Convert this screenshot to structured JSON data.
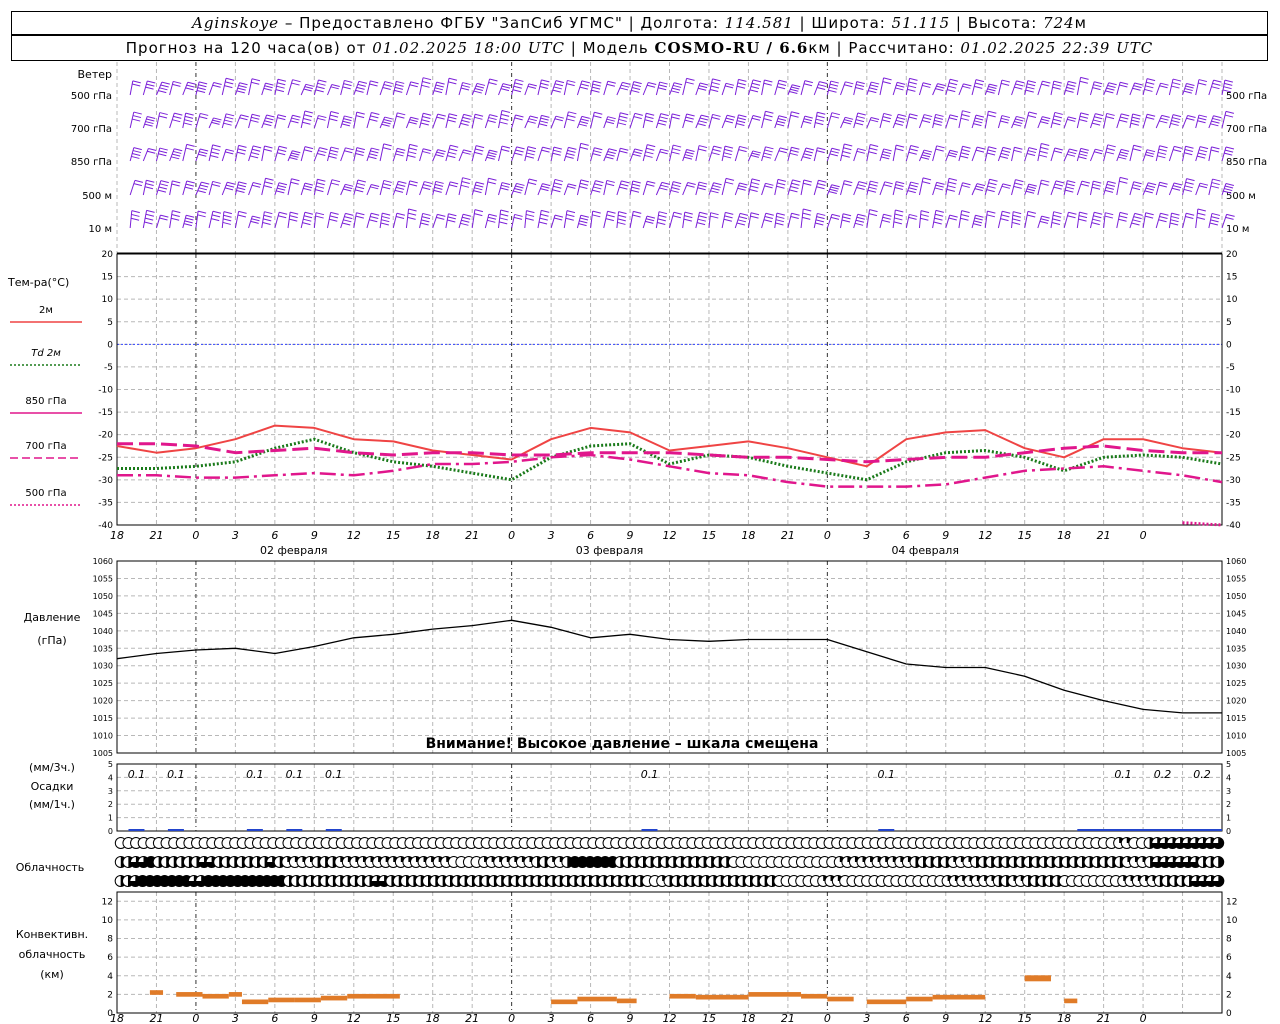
{
  "header": {
    "line1": {
      "station": "Aginskoye",
      "provider": " – Предоставлено ФГБУ \"ЗапСиб УГМС\" | Долгота: ",
      "longitude": "114.581",
      "lat_label": " | Широта: ",
      "latitude": "51.115",
      "alt_label": " | Высота: ",
      "altitude": "724",
      "alt_unit": "м"
    },
    "line2": {
      "forecast_label": "Прогноз на 120 часа(ов) от ",
      "issued": "01.02.2025 18:00 UTC",
      "model_label": " | Модель ",
      "model": "COSMO-RU / 6.6",
      "model_unit": "км",
      "calc_label": " | Рассчитано: ",
      "calculated": "01.02.2025 22:39 UTC"
    }
  },
  "axis": {
    "hour_ticks": [
      "18",
      "21",
      "0",
      "3",
      "6",
      "9",
      "12",
      "15",
      "18",
      "21",
      "0",
      "3",
      "6",
      "9",
      "12",
      "15",
      "18",
      "21",
      "0",
      "3",
      "6",
      "9",
      "12",
      "15",
      "18",
      "21",
      "0"
    ],
    "dates": [
      "02 февраля",
      "03 февраля",
      "04 февраля"
    ]
  },
  "panels": {
    "wind": {
      "title": "Ветер",
      "levels": [
        "500 гПа",
        "700 гПа",
        "850 гПа",
        "500 м",
        "10 м"
      ],
      "color": "#7b1fd8"
    },
    "temperature": {
      "title": "Тем-ра(°C)",
      "legend": [
        {
          "label": "2м",
          "color": "#ef4444",
          "style": "solid"
        },
        {
          "label": "Td 2м",
          "color": "#1a7a1a",
          "style": "dotted"
        },
        {
          "label": "850 гПа",
          "color": "#e0168c",
          "style": "solid"
        },
        {
          "label": "700 гПа",
          "color": "#e0168c",
          "style": "dashed"
        },
        {
          "label": "500 гПа",
          "color": "#e0168c",
          "style": "dotted"
        }
      ],
      "ticks": [
        "20",
        "15",
        "10",
        "5",
        "0",
        "-5",
        "-10",
        "-15",
        "-20",
        "-25",
        "-30",
        "-35",
        "-40"
      ]
    },
    "pressure": {
      "title1": "Давление",
      "title2": "(гПа)",
      "ticks": [
        "1060",
        "1055",
        "1050",
        "1045",
        "1040",
        "1035",
        "1030",
        "1025",
        "1020",
        "1015",
        "1010",
        "1005"
      ],
      "warning": "Внимание! Высокое давление – шкала смещена"
    },
    "precip": {
      "unit3h": "(мм/3ч.)",
      "title": "Осадки",
      "unit1h": "(мм/1ч.)",
      "ticks": [
        "5",
        "4",
        "3",
        "2",
        "1",
        "0"
      ],
      "labels": [
        "0.1",
        "0.1",
        "0.1",
        "0.1",
        "0.1",
        "0.1",
        "0.1",
        "0.1",
        "0.2",
        "0.2"
      ]
    },
    "cloud": {
      "title": "Облачность"
    },
    "convective": {
      "title1": "Конвективн.",
      "title2": "облачность",
      "title3": "(км)",
      "ticks": [
        "12",
        "10",
        "8",
        "6",
        "4",
        "2",
        "0"
      ]
    }
  },
  "chart_data": [
    {
      "type": "line",
      "title": "Тем-ра(°C)",
      "x_hours": [
        -6,
        -3,
        0,
        3,
        6,
        9,
        12,
        15,
        18,
        21,
        24,
        27,
        30,
        33,
        36,
        39,
        42,
        45,
        48,
        51,
        54,
        57,
        60,
        63,
        66,
        69,
        72,
        75,
        78
      ],
      "ylim": [
        -40,
        20
      ],
      "series": [
        {
          "name": "2м",
          "values": [
            -22.5,
            -24,
            -23,
            -21,
            -18,
            -18.5,
            -21,
            -21.5,
            -23.5,
            -24.5,
            -25.5,
            -21,
            -18.5,
            -19.5,
            -23.5,
            -22.5,
            -21.5,
            -23,
            -25,
            -27,
            -21,
            -19.5,
            -19,
            -23,
            -25,
            -21,
            -21,
            -23,
            -24
          ]
        },
        {
          "name": "Td 2м",
          "values": [
            -27.5,
            -27.5,
            -27,
            -26,
            -23,
            -21,
            -24,
            -26,
            -27,
            -28.5,
            -30,
            -25,
            -22.5,
            -22,
            -26.5,
            -24.5,
            -25,
            -27,
            -28.5,
            -30,
            -26,
            -24,
            -23.5,
            -25,
            -28,
            -25,
            -24.5,
            -25,
            -26.5
          ]
        },
        {
          "name": "850 гПа",
          "values": [
            -22,
            -22,
            -22.5,
            -24,
            -23.5,
            -23,
            -24,
            -24.5,
            -24,
            -24,
            -24.5,
            -24.5,
            -24,
            -24,
            -24,
            -24.5,
            -25,
            -25,
            -25.5,
            -26,
            -25.5,
            -25,
            -25,
            -24,
            -23,
            -22.5,
            -23.5,
            -24,
            -24
          ]
        },
        {
          "name": "700 гПа",
          "values": [
            -29,
            -29,
            -29.5,
            -29.5,
            -29,
            -28.5,
            -29,
            -28,
            -26.5,
            -26.5,
            -26,
            -25,
            -24.5,
            -25.5,
            -27,
            -28.5,
            -29,
            -30.5,
            -31.5,
            -31.5,
            -31.5,
            -31,
            -29.5,
            -28,
            -27.5,
            -27,
            -28,
            -29,
            -30.5
          ]
        },
        {
          "name": "500 гПа",
          "values": [
            null,
            null,
            null,
            null,
            null,
            null,
            null,
            null,
            null,
            null,
            null,
            null,
            null,
            null,
            null,
            null,
            null,
            null,
            null,
            null,
            null,
            null,
            null,
            null,
            null,
            null,
            null,
            -39.5,
            -40
          ]
        }
      ]
    },
    {
      "type": "line",
      "title": "Давление",
      "x_hours": [
        -6,
        -3,
        0,
        3,
        6,
        9,
        12,
        15,
        18,
        21,
        24,
        27,
        30,
        33,
        36,
        39,
        42,
        45,
        48,
        51,
        54,
        57,
        60,
        63,
        66,
        69,
        72,
        75,
        78
      ],
      "ylim": [
        1005,
        1060
      ],
      "ylabel": "(гПа)",
      "series": [
        {
          "name": "",
          "values": [
            1032,
            1033.5,
            1034.5,
            1035,
            1033.5,
            1035.5,
            1038,
            1039,
            1040.5,
            1041.5,
            1043,
            1041,
            1038,
            1039,
            1037.5,
            1037,
            1037.5,
            1037.5,
            1037.5,
            1034,
            1030.5,
            1029.5,
            1029.5,
            1027,
            1023,
            1020,
            1017.5,
            1016.5,
            1016.5
          ]
        }
      ]
    },
    {
      "type": "bar",
      "title": "Осадки",
      "ylabel": "(мм/3ч.) / (мм/1ч.)",
      "ylim": [
        0,
        5
      ],
      "x_hours": [
        -3,
        0,
        6,
        9,
        12,
        36,
        54,
        72,
        75,
        78
      ],
      "values_3h": [
        0.1,
        0.1,
        0.1,
        0.1,
        0.1,
        0.1,
        0.1,
        0.1,
        0.2,
        0.2
      ]
    },
    {
      "type": "bar",
      "title": "Конвективн. облачность",
      "ylabel": "(км)",
      "ylim": [
        0,
        13
      ],
      "segments": [
        {
          "x0": -3.5,
          "x1": -2.5,
          "value": 2.2
        },
        {
          "x0": -1.5,
          "x1": 0.5,
          "value": 2.0
        },
        {
          "x0": 0.5,
          "x1": 2.5,
          "value": 1.8
        },
        {
          "x0": 2.5,
          "x1": 3.5,
          "value": 2.0
        },
        {
          "x0": 3.5,
          "x1": 5.5,
          "value": 1.2
        },
        {
          "x0": 5.5,
          "x1": 7.5,
          "value": 1.4
        },
        {
          "x0": 7.5,
          "x1": 9.5,
          "value": 1.4
        },
        {
          "x0": 9.5,
          "x1": 11.5,
          "value": 1.6
        },
        {
          "x0": 11.5,
          "x1": 15.5,
          "value": 1.8
        },
        {
          "x0": 27,
          "x1": 29,
          "value": 1.2
        },
        {
          "x0": 29,
          "x1": 32,
          "value": 1.5
        },
        {
          "x0": 32,
          "x1": 33.5,
          "value": 1.3
        },
        {
          "x0": 36,
          "x1": 38,
          "value": 1.8
        },
        {
          "x0": 38,
          "x1": 42,
          "value": 1.7
        },
        {
          "x0": 42,
          "x1": 46,
          "value": 2.0
        },
        {
          "x0": 46,
          "x1": 48,
          "value": 1.8
        },
        {
          "x0": 48,
          "x1": 50,
          "value": 1.5
        },
        {
          "x0": 51,
          "x1": 54,
          "value": 1.2
        },
        {
          "x0": 54,
          "x1": 56,
          "value": 1.5
        },
        {
          "x0": 56,
          "x1": 60,
          "value": 1.7
        },
        {
          "x0": 63,
          "x1": 65,
          "value": 3.8
        },
        {
          "x0": 66,
          "x1": 67,
          "value": 1.3
        }
      ]
    }
  ],
  "cloud_rows": {
    "row1": [
      0,
      0,
      0,
      0,
      0,
      0,
      0,
      0,
      0,
      0,
      0,
      0,
      0,
      0,
      0,
      0,
      0,
      0,
      0,
      0,
      0,
      0,
      0,
      0,
      0,
      0,
      0,
      0,
      0,
      0,
      0,
      0,
      0,
      0,
      0,
      0,
      0,
      0,
      0,
      0,
      0,
      0,
      0,
      0,
      0,
      0,
      0,
      0,
      0,
      0,
      0,
      0,
      0,
      0,
      0,
      0,
      0,
      0,
      0,
      0,
      0,
      0,
      0,
      0,
      0,
      0,
      0,
      0,
      0,
      0,
      0,
      0,
      0,
      0,
      0,
      0,
      0,
      0,
      0,
      0,
      0,
      0,
      0,
      0,
      0,
      0,
      0,
      0,
      0,
      0,
      0,
      0,
      0,
      0,
      0,
      0,
      0,
      0,
      0,
      0,
      0,
      0,
      0,
      0,
      0,
      0,
      0,
      0,
      0,
      0,
      0,
      0,
      0,
      0,
      0,
      0,
      0,
      0,
      0,
      0,
      0,
      0,
      0,
      0,
      0,
      0,
      0,
      0,
      0,
      0,
      0,
      1,
      1,
      0,
      0,
      2,
      3,
      3,
      3,
      3,
      3,
      3,
      3,
      3,
      3
    ],
    "row2": [
      2,
      2,
      3,
      3,
      4,
      2,
      2,
      2,
      2,
      2,
      2,
      3,
      3,
      2,
      2,
      2,
      2,
      2,
      2,
      2,
      3,
      2,
      1,
      1,
      1,
      1,
      2,
      2,
      2,
      1,
      1,
      1,
      1,
      1,
      1,
      1,
      1,
      1,
      1,
      1,
      1,
      1,
      1,
      1,
      0,
      0,
      0,
      0,
      1,
      1,
      1,
      1,
      1,
      1,
      1,
      2,
      2,
      1,
      1,
      2,
      4,
      4,
      4,
      4,
      4,
      4,
      2,
      2,
      2,
      2,
      2,
      2,
      2,
      2,
      2,
      2,
      2,
      2,
      2,
      2,
      2,
      0,
      0,
      0,
      0,
      0,
      0,
      0,
      0,
      0,
      0,
      0,
      0,
      0,
      0,
      1,
      1,
      1,
      1,
      1,
      1,
      1,
      1,
      1,
      1,
      2,
      2,
      2,
      2,
      2,
      1,
      1,
      1,
      2,
      2,
      2,
      2,
      2,
      2,
      2,
      2,
      2,
      2,
      2,
      2,
      2,
      2,
      2,
      2,
      2,
      2,
      2,
      2,
      1,
      1,
      1,
      2,
      3,
      3,
      3,
      3,
      3,
      3,
      2,
      2,
      2
    ],
    "row3": [
      2,
      2,
      3,
      4,
      4,
      4,
      4,
      4,
      4,
      4,
      3,
      3,
      4,
      4,
      4,
      4,
      4,
      4,
      4,
      4,
      4,
      4,
      4,
      2,
      2,
      2,
      2,
      2,
      2,
      2,
      2,
      2,
      2,
      2,
      2,
      3,
      3,
      2,
      2,
      2,
      2,
      2,
      2,
      2,
      2,
      2,
      2,
      2,
      2,
      2,
      2,
      2,
      2,
      2,
      2,
      2,
      2,
      2,
      2,
      2,
      2,
      2,
      2,
      2,
      2,
      2,
      2,
      2,
      2,
      2,
      2,
      2,
      0,
      0,
      1,
      2,
      2,
      2,
      2,
      2,
      2,
      2,
      2,
      2,
      2,
      2,
      2,
      2,
      2,
      2,
      0,
      0,
      0,
      0,
      0,
      0,
      1,
      1,
      1,
      0,
      0,
      0,
      0,
      0,
      0,
      0,
      0,
      0,
      0,
      0,
      0,
      0,
      0,
      1,
      1,
      1,
      1,
      1,
      1,
      1,
      2,
      2,
      1,
      1,
      2,
      2,
      2,
      2,
      2,
      0,
      0,
      0,
      0,
      0,
      0,
      0,
      0,
      1,
      1,
      1,
      1,
      1,
      2,
      2,
      2,
      2,
      2,
      3,
      3,
      3,
      3
    ]
  }
}
